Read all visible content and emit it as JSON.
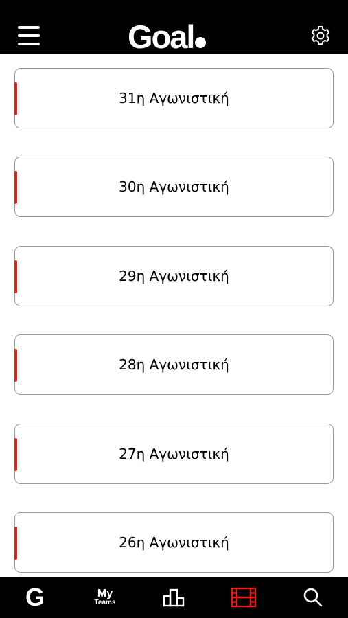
{
  "header": {
    "logo_text": "Goal",
    "icons": {
      "menu": "hamburger-menu-icon",
      "settings": "gear-icon"
    }
  },
  "rounds": [
    {
      "label": "31η Αγωνιστική"
    },
    {
      "label": "30η Αγωνιστική"
    },
    {
      "label": "29η Αγωνιστική"
    },
    {
      "label": "28η Αγωνιστική"
    },
    {
      "label": "27η Αγωνιστική"
    },
    {
      "label": "26η Αγωνιστική"
    }
  ],
  "tabbar": {
    "home_glyph": "G",
    "my_teams_line1": "My",
    "my_teams_line2": "Teams",
    "icons": {
      "home": "goal-g-icon",
      "standings": "podium-icon",
      "videos": "film-strip-icon",
      "search": "search-icon"
    },
    "active_tab": "videos"
  },
  "colors": {
    "header_bg": "#000000",
    "accent": "#e2231a",
    "card_border": "#9a9a9a",
    "text": "#000000"
  }
}
